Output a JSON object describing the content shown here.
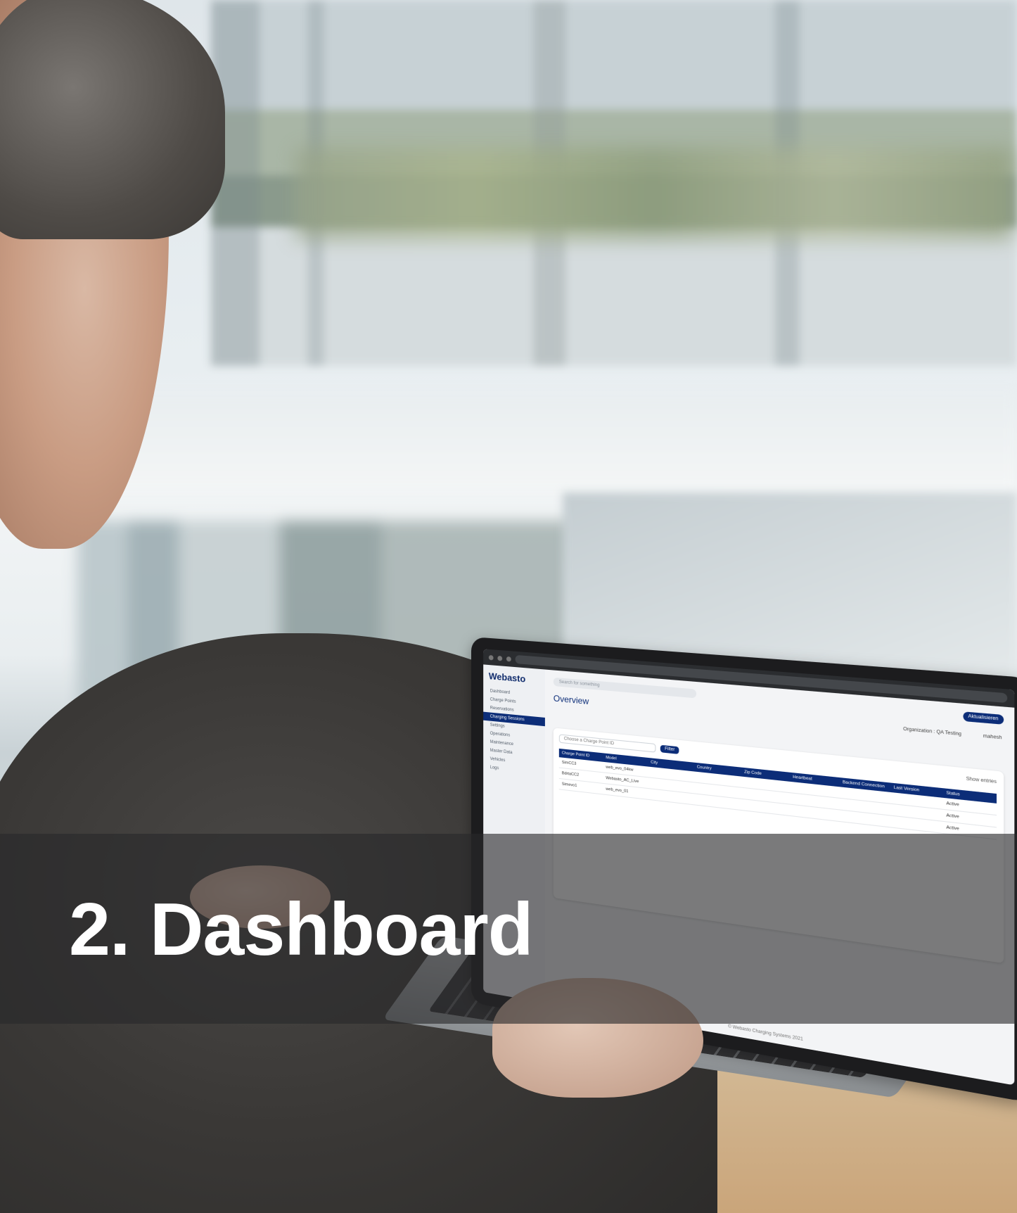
{
  "title": "2. Dashboard",
  "laptop_screen": {
    "logo": "Webasto",
    "search_placeholder": "Search for something",
    "cta": "Aktualisieren",
    "overview": "Overview",
    "organization": "Organization : QA Testing",
    "user": "mahesh",
    "sidebar": [
      "Dashboard",
      "Charge Points",
      "Reservations",
      "Charging Sessions",
      "Settings",
      "Operations",
      "Maintenance",
      "Master Data",
      "Vehicles",
      "Logs"
    ],
    "filter_placeholder": "Choose a Charge Point ID",
    "filter_button": "Filter",
    "show_entries": "Show entries",
    "table_headers": [
      "Charge Point ID",
      "Model",
      "City",
      "Country",
      "Zip Code",
      "Heartbeat",
      "Backend Connection",
      "Last Version",
      "Status"
    ],
    "rows": [
      [
        "SimCC3",
        "web_evo_04kw",
        "",
        "",
        "",
        "",
        "",
        "",
        "Active"
      ],
      [
        "BdrtaCC2",
        "Webasto_AC_Live",
        "",
        "",
        "",
        "",
        "",
        "",
        "Active"
      ],
      [
        "Simevo1",
        "web_evo_01",
        "",
        "",
        "",
        "",
        "",
        "",
        "Active"
      ]
    ],
    "footer": "© Webasto Charging Systems 2021"
  },
  "colors": {
    "band": "#2a2a2c",
    "title": "#ffffff",
    "brand_navy": "#0c2d78"
  }
}
